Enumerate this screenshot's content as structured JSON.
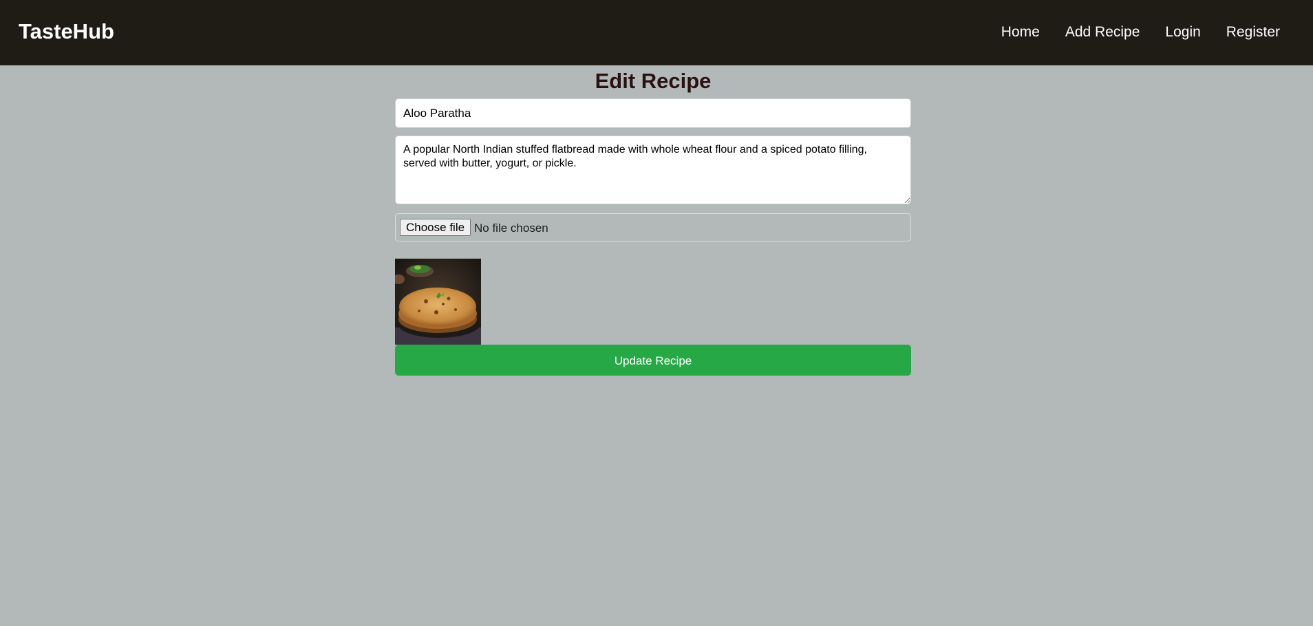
{
  "navbar": {
    "brand": "TasteHub",
    "links": [
      "Home",
      "Add Recipe",
      "Login",
      "Register"
    ]
  },
  "page": {
    "title": "Edit Recipe"
  },
  "form": {
    "title_value": "Aloo Paratha",
    "description_value": "A popular North Indian stuffed flatbread made with whole wheat flour and a spiced potato filling, served with butter, yogurt, or pickle.",
    "file_button_label": "Choose file",
    "file_status": "No file chosen",
    "submit_label": "Update Recipe"
  },
  "colors": {
    "navbar_bg": "#1f1c16",
    "page_bg": "#b3b9b9",
    "submit_bg": "#26a846",
    "title_text": "#2a1212"
  }
}
